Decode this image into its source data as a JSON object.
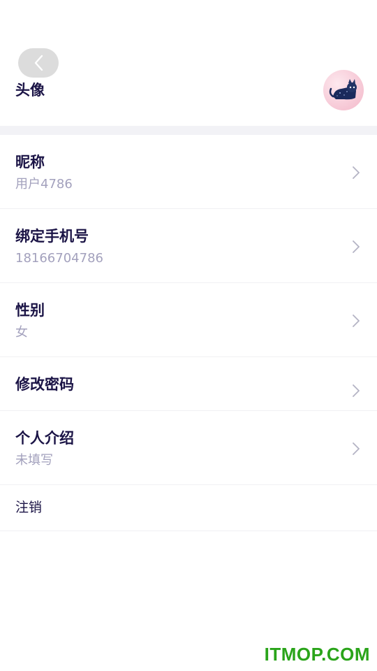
{
  "header": {
    "back_icon": "chevron-left-icon"
  },
  "avatar_row": {
    "label": "头像",
    "avatar_icon": "avatar-image"
  },
  "items": [
    {
      "title": "昵称",
      "value": "用户4786"
    },
    {
      "title": "绑定手机号",
      "value": "18166704786"
    },
    {
      "title": "性别",
      "value": "女"
    },
    {
      "title": "修改密码"
    },
    {
      "title": "个人介绍",
      "value": "未填写"
    }
  ],
  "logout": {
    "label": "注销"
  },
  "watermark": {
    "text": "ITMOP.COM"
  },
  "colors": {
    "title": "#1b1446",
    "subtitle": "#a3a1bd",
    "divider": "#f0f0f3",
    "section_gap": "#f2f2f6",
    "back_button_bg": "#dcdcdc",
    "watermark": "#2aa41a"
  }
}
